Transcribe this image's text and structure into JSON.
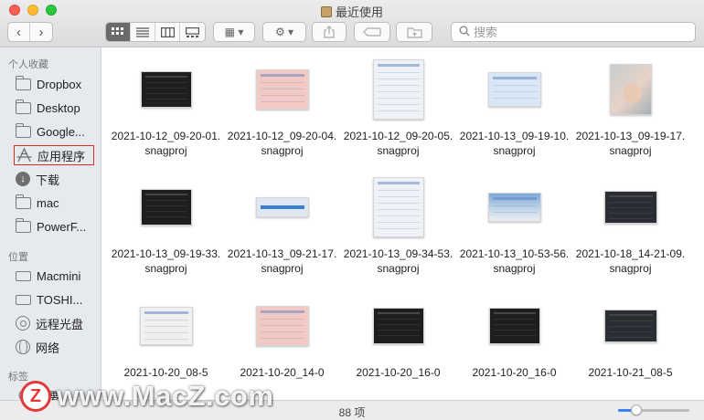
{
  "window": {
    "title": "最近使用",
    "controls": {
      "close_color": "#fd5f57",
      "minimize_color": "#febc2e",
      "zoom_color": "#28c840"
    }
  },
  "toolbar": {
    "back": "‹",
    "forward": "›",
    "views": [
      "icon-view",
      "list-view",
      "column-view",
      "gallery-view"
    ],
    "active_view": "icon-view",
    "group_label": "▦ ▾",
    "action_label": "⚙ ▾",
    "search_placeholder": "搜索"
  },
  "sidebar": {
    "sections": [
      {
        "title": "个人收藏",
        "items": [
          {
            "label": "Dropbox",
            "icon": "folder-icon"
          },
          {
            "label": "Desktop",
            "icon": "folder-icon"
          },
          {
            "label": "Google...",
            "icon": "folder-icon"
          },
          {
            "label": "应用程序",
            "icon": "applications-icon",
            "highlighted": true
          },
          {
            "label": "下载",
            "icon": "download-icon"
          },
          {
            "label": "mac",
            "icon": "folder-icon"
          },
          {
            "label": "PowerF...",
            "icon": "folder-icon"
          }
        ]
      },
      {
        "title": "位置",
        "items": [
          {
            "label": "Macmini",
            "icon": "disk-icon"
          },
          {
            "label": "TOSHI...",
            "icon": "disk-icon"
          },
          {
            "label": "远程光盘",
            "icon": "disc-icon"
          },
          {
            "label": "网络",
            "icon": "globe-icon"
          }
        ]
      },
      {
        "title": "标签",
        "items": [
          {
            "label": "重要",
            "icon": "tag-icon"
          }
        ]
      }
    ]
  },
  "files": [
    {
      "name": "2021-10-12_09-20-01.snagproj",
      "style": "th-dark"
    },
    {
      "name": "2021-10-12_09-20-04.snagproj",
      "style": "th-pink"
    },
    {
      "name": "2021-10-12_09-20-05.snagproj",
      "style": "th-light"
    },
    {
      "name": "2021-10-13_09-19-10.snagproj",
      "style": "th-blue"
    },
    {
      "name": "2021-10-13_09-19-17.snagproj",
      "style": "th-photo"
    },
    {
      "name": "2021-10-13_09-19-33.snagproj",
      "style": "th-dark"
    },
    {
      "name": "2021-10-13_09-21-17.snagproj",
      "style": "th-bar"
    },
    {
      "name": "2021-10-13_09-34-53.snagproj",
      "style": "th-light"
    },
    {
      "name": "2021-10-13_10-53-56.snagproj",
      "style": "th-desk"
    },
    {
      "name": "2021-10-18_14-21-09.snagproj",
      "style": "th-darkwin"
    },
    {
      "name": "2021-10-20_08-5",
      "style": "th-grey"
    },
    {
      "name": "2021-10-20_14-0",
      "style": "th-pink"
    },
    {
      "name": "2021-10-20_16-0",
      "style": "th-dark"
    },
    {
      "name": "2021-10-20_16-0",
      "style": "th-dark"
    },
    {
      "name": "2021-10-21_08-5",
      "style": "th-darkwin"
    }
  ],
  "status": {
    "count_text": "88 项",
    "icon_size_level": 0.25
  },
  "watermark": {
    "logo_letter": "Z",
    "text": "www.MacZ.com",
    "color": "#e23a3a"
  }
}
